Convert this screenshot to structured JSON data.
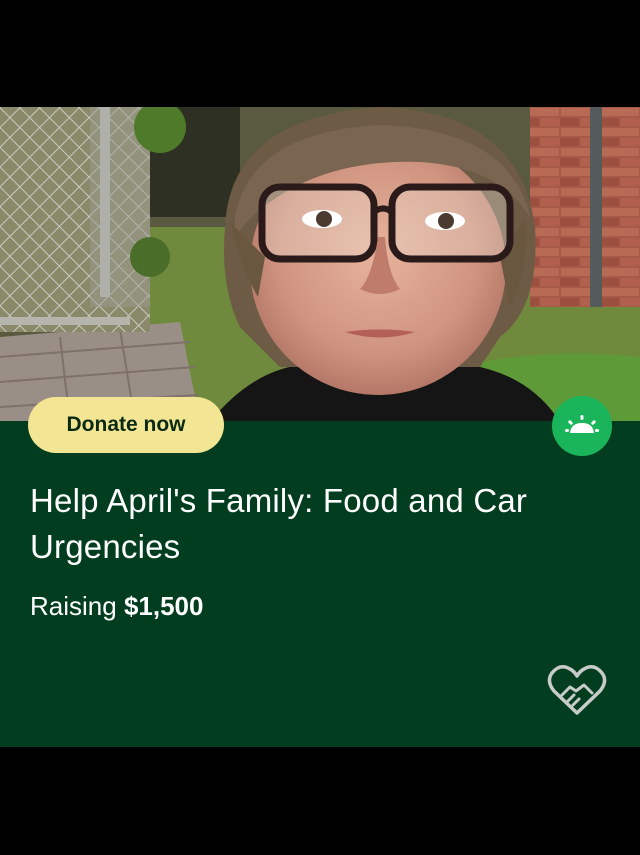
{
  "card": {
    "donate_label": "Donate now",
    "title": "Help April's Family: Food and Car Urgencies",
    "raising_label": "Raising",
    "goal_amount": "$1,500"
  },
  "icons": {
    "badge": "gofundme-sunrise-icon",
    "footer": "heart-handshake-icon"
  },
  "colors": {
    "card_background": "#033d1f",
    "donate_button": "#f2e694",
    "badge": "#1ab45b",
    "page_background": "#000000"
  }
}
